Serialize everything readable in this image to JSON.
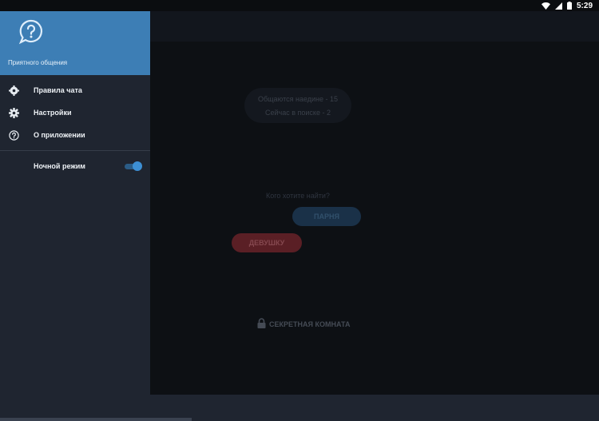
{
  "status_bar": {
    "time": "5:29"
  },
  "drawer": {
    "header_text": "Приятного общения",
    "items": [
      {
        "label": "Правила чата",
        "icon": "gear-rules-icon"
      },
      {
        "label": "Настройки",
        "icon": "settings-icon"
      },
      {
        "label": "О приложении",
        "icon": "help-circle-icon"
      }
    ],
    "night_mode": {
      "label": "Ночной режим",
      "icon": "moon-icon",
      "enabled": true
    }
  },
  "main": {
    "stats": {
      "chatting": "Общаются наедине - 15",
      "searching": "Сейчас в поиске - 2"
    },
    "question": "Кого хотите найти?",
    "guy_button": "ПАРНЯ",
    "girl_button": "ДЕВУШКУ",
    "secret_room": "СЕКРЕТНАЯ КОМНАТА"
  },
  "colors": {
    "accent": "#3d7eb5",
    "drawer_bg": "#1f2530",
    "main_bg": "#0d1014",
    "toggle_on": "#3d8fd4"
  }
}
